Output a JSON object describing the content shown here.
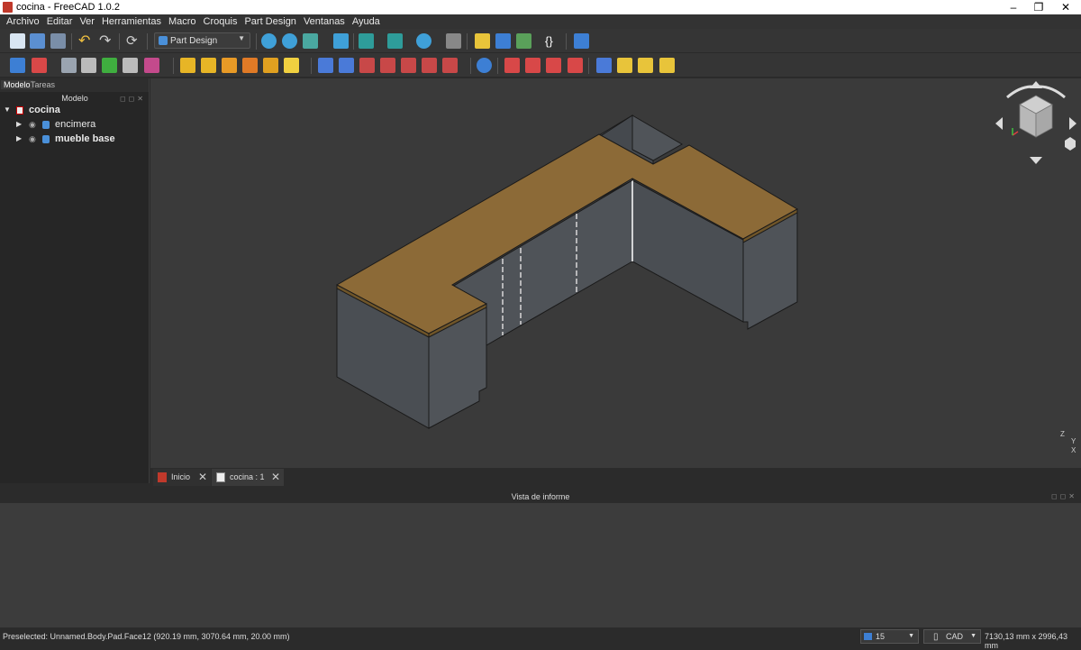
{
  "window": {
    "title": "cocina - FreeCAD 1.0.2"
  },
  "menu": [
    "Archivo",
    "Editar",
    "Ver",
    "Herramientas",
    "Macro",
    "Croquis",
    "Part Design",
    "Ventanas",
    "Ayuda"
  ],
  "workbench": {
    "selected": "Part Design"
  },
  "panel": {
    "tabs": [
      "Modelo",
      "Tareas"
    ],
    "header": "Modelo",
    "tree": [
      {
        "label": "cocina",
        "icon": "document-icon"
      },
      {
        "label": "encimera",
        "icon": "body-icon"
      },
      {
        "label": "mueble base",
        "icon": "body-icon"
      }
    ]
  },
  "doc_tabs": [
    {
      "label": "Inicio",
      "icon": "freecad-icon"
    },
    {
      "label": "cocina : 1",
      "icon": "document-icon"
    }
  ],
  "report": {
    "title": "Vista de informe"
  },
  "status": {
    "message": "Preselected: Unnamed.Body.Pad.Face12 (920.19 mm, 3070.64 mm, 20.00 mm)",
    "zoom": "15",
    "nav_style": "CAD",
    "dimensions": "7130,13 mm x 2996,43 mm"
  },
  "axis_labels": {
    "z": "Z",
    "y": "Y",
    "x": "X"
  },
  "colors": {
    "countertop": "#8c6a37",
    "cabinet": "#4a4e53",
    "background": "#3a3a3a"
  }
}
